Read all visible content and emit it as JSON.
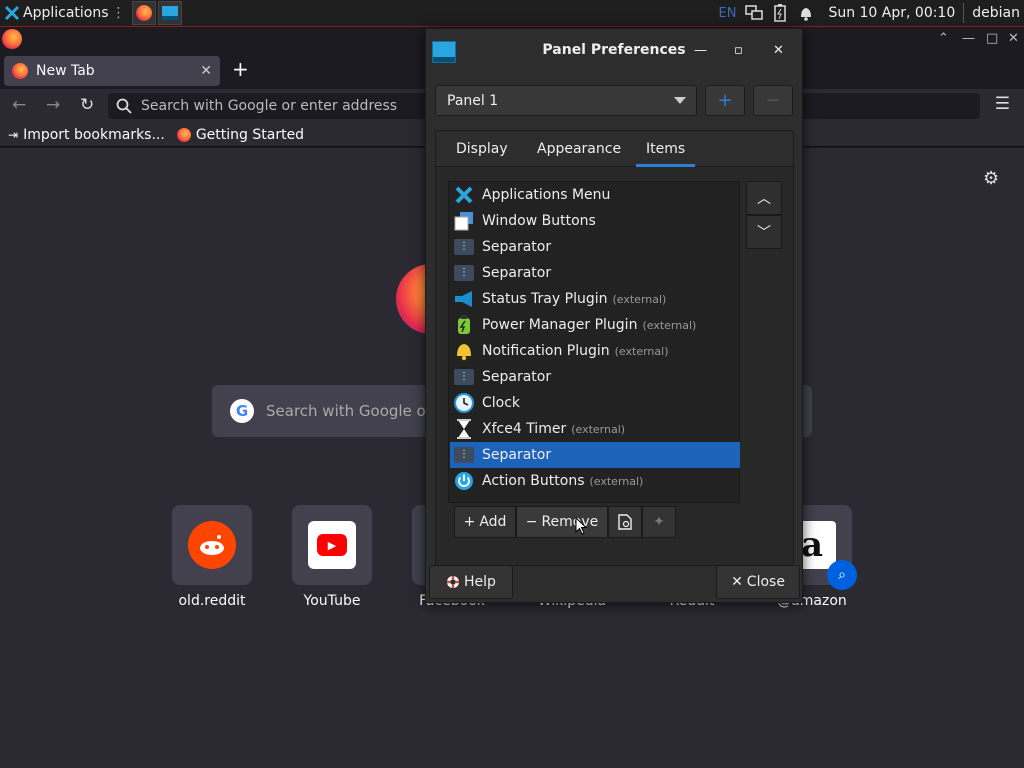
{
  "xfce_panel": {
    "applications_label": "Applications",
    "lang": "EN",
    "clock": "Sun 10 Apr, 00:10",
    "user": "debian"
  },
  "firefox": {
    "tab": {
      "title": "New Tab"
    },
    "url_placeholder": "Search with Google or enter address",
    "bookmarks": [
      "Import bookmarks...",
      "Getting Started"
    ],
    "search_placeholder": "Search with Google or enter address",
    "shortcuts": [
      {
        "label": "old.reddit",
        "icon": "reddit-icon"
      },
      {
        "label": "YouTube",
        "icon": "youtube-icon"
      },
      {
        "label": "Facebook",
        "icon": "facebook-icon"
      },
      {
        "label": "Wikipedia",
        "icon": "wikipedia-icon"
      },
      {
        "label": "Reddit",
        "icon": "reddit-icon"
      },
      {
        "label": "@amazon",
        "icon": "amazon-icon"
      }
    ]
  },
  "dialog": {
    "title": "Panel Preferences",
    "panel_select": "Panel 1",
    "tabs": [
      "Display",
      "Appearance",
      "Items"
    ],
    "active_tab": "Items",
    "items": [
      {
        "name": "Applications Menu",
        "ext": "",
        "icon": "applications-menu-icon"
      },
      {
        "name": "Window Buttons",
        "ext": "",
        "icon": "window-buttons-icon"
      },
      {
        "name": "Separator",
        "ext": "",
        "icon": "separator-icon"
      },
      {
        "name": "Separator",
        "ext": "",
        "icon": "separator-icon"
      },
      {
        "name": "Status Tray Plugin",
        "ext": "(external)",
        "icon": "status-tray-icon"
      },
      {
        "name": "Power Manager Plugin",
        "ext": "(external)",
        "icon": "battery-icon"
      },
      {
        "name": "Notification Plugin",
        "ext": "(external)",
        "icon": "bell-icon"
      },
      {
        "name": "Separator",
        "ext": "",
        "icon": "separator-icon"
      },
      {
        "name": "Clock",
        "ext": "",
        "icon": "clock-icon"
      },
      {
        "name": "Xfce4 Timer",
        "ext": "(external)",
        "icon": "hourglass-icon"
      },
      {
        "name": "Separator",
        "ext": "",
        "icon": "separator-icon"
      },
      {
        "name": "Action Buttons",
        "ext": "(external)",
        "icon": "power-icon"
      }
    ],
    "selected_index": 10,
    "add_label": "Add",
    "remove_label": "Remove",
    "help_label": "Help",
    "close_label": "Close"
  },
  "colors": {
    "accent": "#1d63ba",
    "tab_underline": "#2f7fd5",
    "panel_border": "#8a1d1d"
  }
}
